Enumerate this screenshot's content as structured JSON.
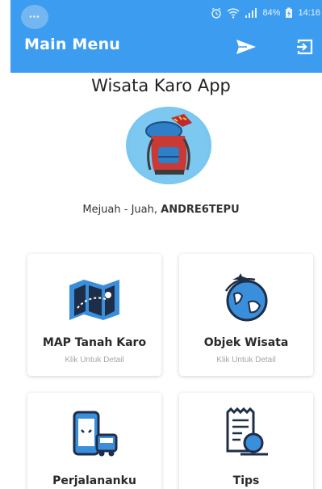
{
  "statusbar": {
    "battery": "84%",
    "time": "14:16"
  },
  "toolbar": {
    "title": "Main Menu",
    "send_icon": "send-icon",
    "logout_icon": "logout-icon",
    "color": "#3c9df0"
  },
  "header": {
    "app_title": "Wisata Karo App",
    "greeting": "Mejuah - Juah,",
    "username": "ANDRE6TEPU"
  },
  "menu": [
    {
      "label": "MAP Tanah Karo",
      "subtitle": "Klik Untuk Detail",
      "icon": "map-icon"
    },
    {
      "label": "Objek Wisata",
      "subtitle": "Klik Untuk Detail",
      "icon": "globe-plane-icon"
    },
    {
      "label": "Perjalananku",
      "icon": "phone-bus-icon"
    },
    {
      "label": "Tips",
      "icon": "receipt-search-icon"
    }
  ]
}
